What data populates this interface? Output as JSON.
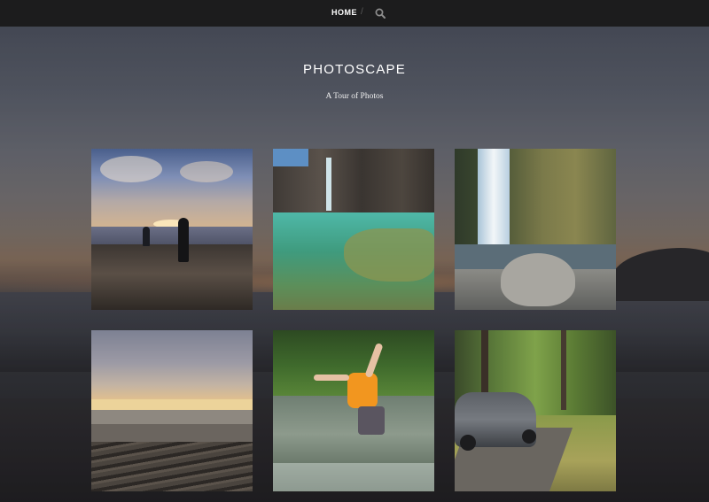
{
  "nav": {
    "home_label": "HOME",
    "separator": "/",
    "search_icon": "search-icon"
  },
  "site": {
    "title": "PHOTOSCAPE",
    "tagline": "A Tour of Photos"
  },
  "gallery": {
    "photos": [
      {
        "subject": "silhouettes-on-rocky-shore-at-sunset"
      },
      {
        "subject": "clear-green-pool-below-basalt-cliffs"
      },
      {
        "subject": "waterfall-over-mossy-rocks"
      },
      {
        "subject": "driftwood-beach-at-dusk"
      },
      {
        "subject": "boy-kneeling-in-stream"
      },
      {
        "subject": "grey-car-on-forest-road"
      }
    ]
  },
  "colors": {
    "nav_background": "#1c1c1d",
    "text": "#ffffff"
  }
}
